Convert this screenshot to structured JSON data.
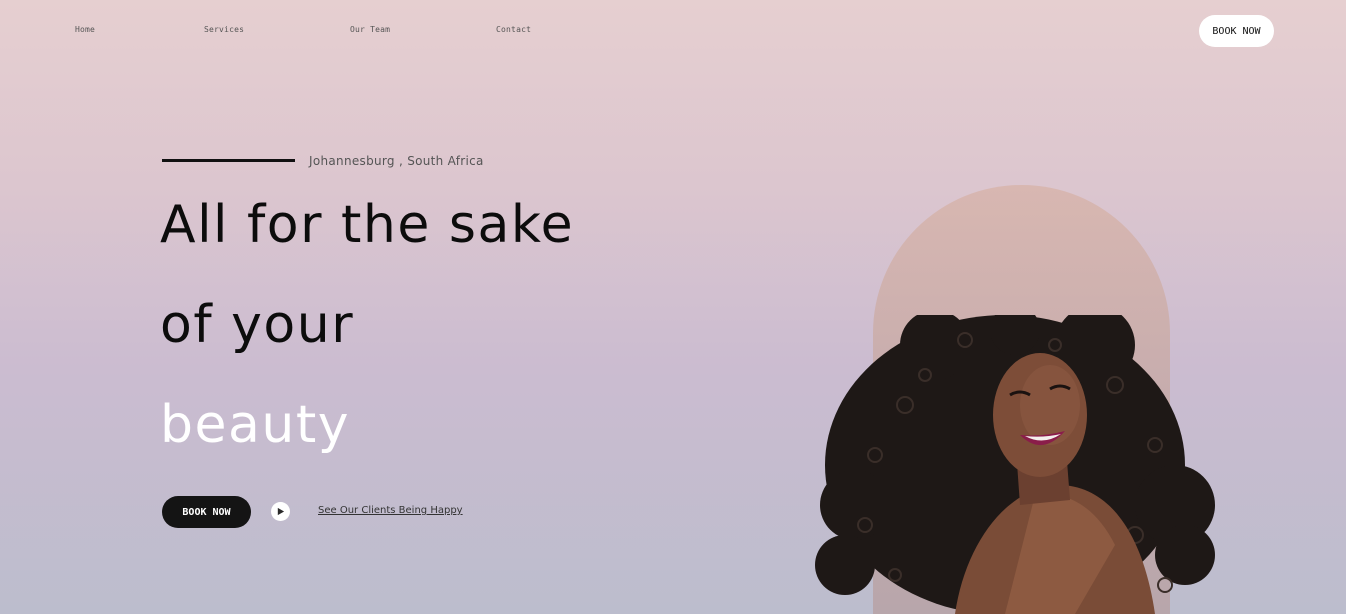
{
  "nav": {
    "items": [
      {
        "label": "Home"
      },
      {
        "label": "Services"
      },
      {
        "label": "Our Team"
      },
      {
        "label": "Contact"
      }
    ],
    "cta_label": "BOOK NOW"
  },
  "hero": {
    "location": "Johannesburg , South Africa",
    "headline_line1": "All for the sake",
    "headline_line2": "of your",
    "headline_line3": "beauty",
    "cta_label": "BOOK NOW",
    "video_link": "See Our Clients Being Happy",
    "image_alt": "smiling woman with curly hair"
  },
  "colors": {
    "accent_dark": "#141414",
    "highlight_text": "#ffffff",
    "arch": "#d0b0ad"
  },
  "icons": {
    "play": "play-icon"
  }
}
